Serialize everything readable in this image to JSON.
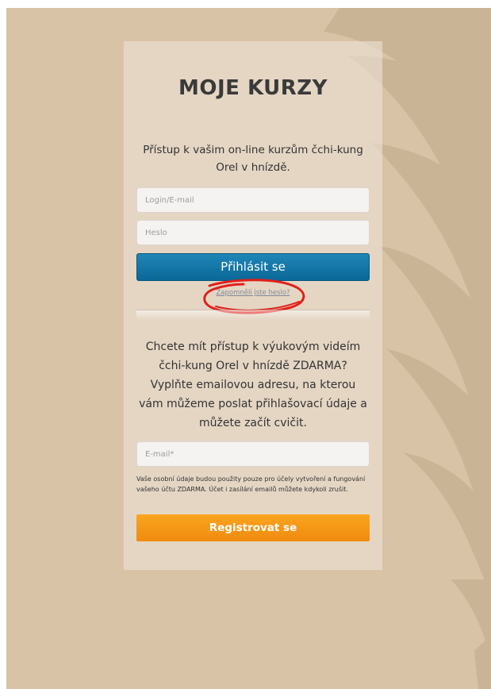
{
  "title": "MOJE KURZY",
  "subtitle": "Přístup k vašim on-line kurzům čchi-kung Orel v hnízdě.",
  "login_form": {
    "login_placeholder": "Login/E-mail",
    "password_placeholder": "Heslo",
    "login_button": "Přihlásit se",
    "forgot_link": "Zapomněli jste heslo?"
  },
  "register_section": {
    "intro": "Chcete mít přístup k výukovým videím čchi-kung Orel v hnízdě ZDARMA? Vyplňte emailovou adresu, na kterou vám můžeme poslat přihlašovací údaje a můžete začít cvičit.",
    "email_placeholder": "E-mail*",
    "privacy_notice": "Vaše osobní údaje budou použity pouze pro účely vytvoření a fungování vašeho účtu ZDARMA. Účet i zasílání emailů můžete kdykoli zrušit.",
    "register_button": "Registrovat se"
  },
  "colors": {
    "background": "#d9c3a6",
    "login_button": "#0f74a6",
    "register_button": "#f7981a",
    "annotation": "#e0201b"
  },
  "icons": [
    "eagle-wing-background",
    "annotation-circle"
  ]
}
